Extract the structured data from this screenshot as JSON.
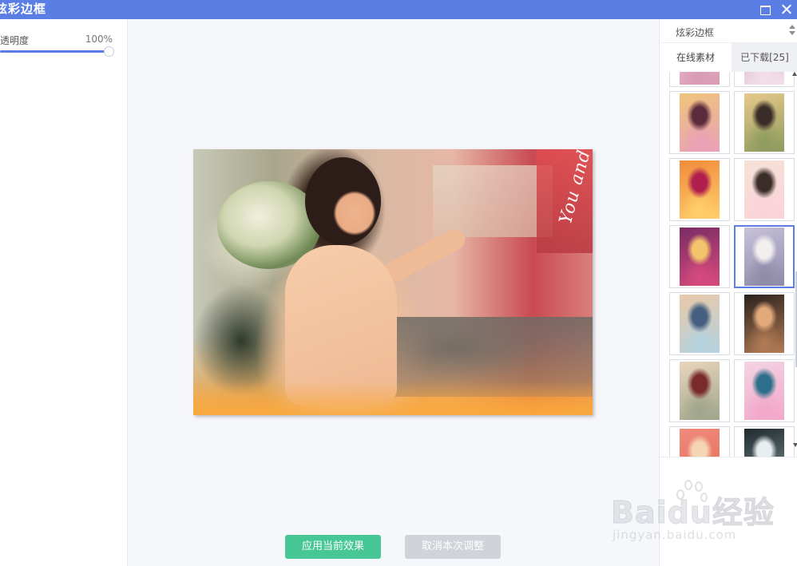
{
  "window": {
    "title": "炫彩边框",
    "maximize_icon": "maximize-icon",
    "close_icon": "close-icon"
  },
  "left_panel": {
    "opacity_label": "透明度",
    "opacity_value": "100%",
    "opacity_fraction": 1.0
  },
  "canvas": {
    "photo_signature": "You and me",
    "apply_label": "应用当前效果",
    "cancel_label": "取消本次调整"
  },
  "right_panel": {
    "category_select": "炫彩边框",
    "tabs": [
      {
        "label": "在线素材",
        "active": true
      },
      {
        "label": "已下载[25]",
        "active": false
      }
    ],
    "thumbnails": [
      {
        "id": "frame-1",
        "selected": false,
        "palette": [
          "#f0c6d4",
          "#6d4b5a",
          "#d99ab4"
        ]
      },
      {
        "id": "frame-2",
        "selected": false,
        "palette": [
          "#d7a9c9",
          "#a45c84",
          "#f2e0ea"
        ]
      },
      {
        "id": "frame-3",
        "selected": false,
        "palette": [
          "#f0c57a",
          "#5b2b3c",
          "#e9a0b8"
        ]
      },
      {
        "id": "frame-4",
        "selected": false,
        "palette": [
          "#e7c98a",
          "#3a2c28",
          "#8d9b5e"
        ]
      },
      {
        "id": "frame-5",
        "selected": false,
        "palette": [
          "#f08a3b",
          "#b01e4e",
          "#ffcf6a"
        ]
      },
      {
        "id": "frame-6",
        "selected": false,
        "palette": [
          "#f6e2d6",
          "#3b2d2a",
          "#fbd2da"
        ]
      },
      {
        "id": "frame-7",
        "selected": false,
        "palette": [
          "#7a2c64",
          "#f4c46c",
          "#d74a7e"
        ]
      },
      {
        "id": "frame-8",
        "selected": true,
        "palette": [
          "#c7c1d9",
          "#f2efef",
          "#8f8aa8"
        ]
      },
      {
        "id": "frame-9",
        "selected": false,
        "palette": [
          "#e9c9a8",
          "#445f80",
          "#b4d2e0"
        ]
      },
      {
        "id": "frame-10",
        "selected": false,
        "palette": [
          "#2a211d",
          "#e2a97a",
          "#b27b55"
        ]
      },
      {
        "id": "frame-11",
        "selected": false,
        "palette": [
          "#e9d6bd",
          "#7a2a2a",
          "#9fa58b"
        ]
      },
      {
        "id": "frame-12",
        "selected": false,
        "palette": [
          "#f3d4e3",
          "#2d6f8a",
          "#f2a7c9"
        ]
      },
      {
        "id": "frame-13",
        "selected": false,
        "palette": [
          "#f08b7e",
          "#f4d6b5",
          "#e46a50"
        ]
      },
      {
        "id": "frame-14",
        "selected": false,
        "palette": [
          "#1f2a2d",
          "#e6eef0",
          "#7c8d90"
        ]
      }
    ]
  },
  "watermark": {
    "text": "Baidu经验",
    "url": "jingyan.baidu.com"
  },
  "colors": {
    "accent": "#5b7ee5",
    "apply_button": "#47c795",
    "cancel_button": "#d1d3da"
  }
}
